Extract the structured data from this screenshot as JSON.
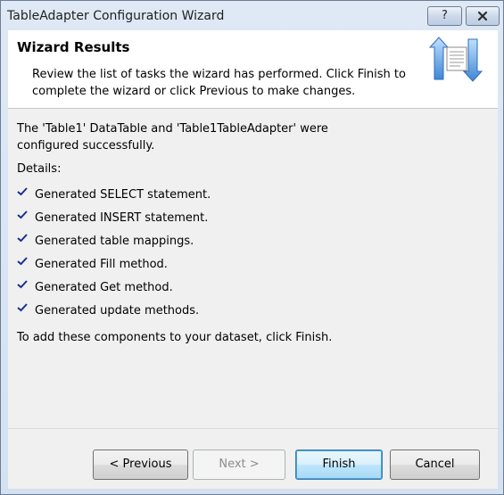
{
  "window": {
    "title": "TableAdapter Configuration Wizard",
    "help_label": "?"
  },
  "header": {
    "title": "Wizard Results",
    "description": "Review the list of tasks the wizard has performed. Click Finish to complete the wizard or click Previous to make changes."
  },
  "content": {
    "message": "The 'Table1' DataTable and 'Table1TableAdapter' were configured successfully.",
    "details_label": "Details:",
    "tasks": [
      "Generated SELECT statement.",
      "Generated INSERT statement.",
      "Generated table mappings.",
      "Generated Fill method.",
      "Generated Get method.",
      "Generated update methods."
    ],
    "finish_note": "To add these components to your dataset, click Finish."
  },
  "buttons": {
    "previous": "< Previous",
    "next": "Next >",
    "finish": "Finish",
    "cancel": "Cancel"
  },
  "colors": {
    "check": "#1a2f8f",
    "finish_border": "#3c7fb1"
  },
  "icons": {
    "help": "help-icon",
    "close": "close-icon",
    "wizard": "wizard-arrows-icon",
    "check": "check-icon"
  }
}
